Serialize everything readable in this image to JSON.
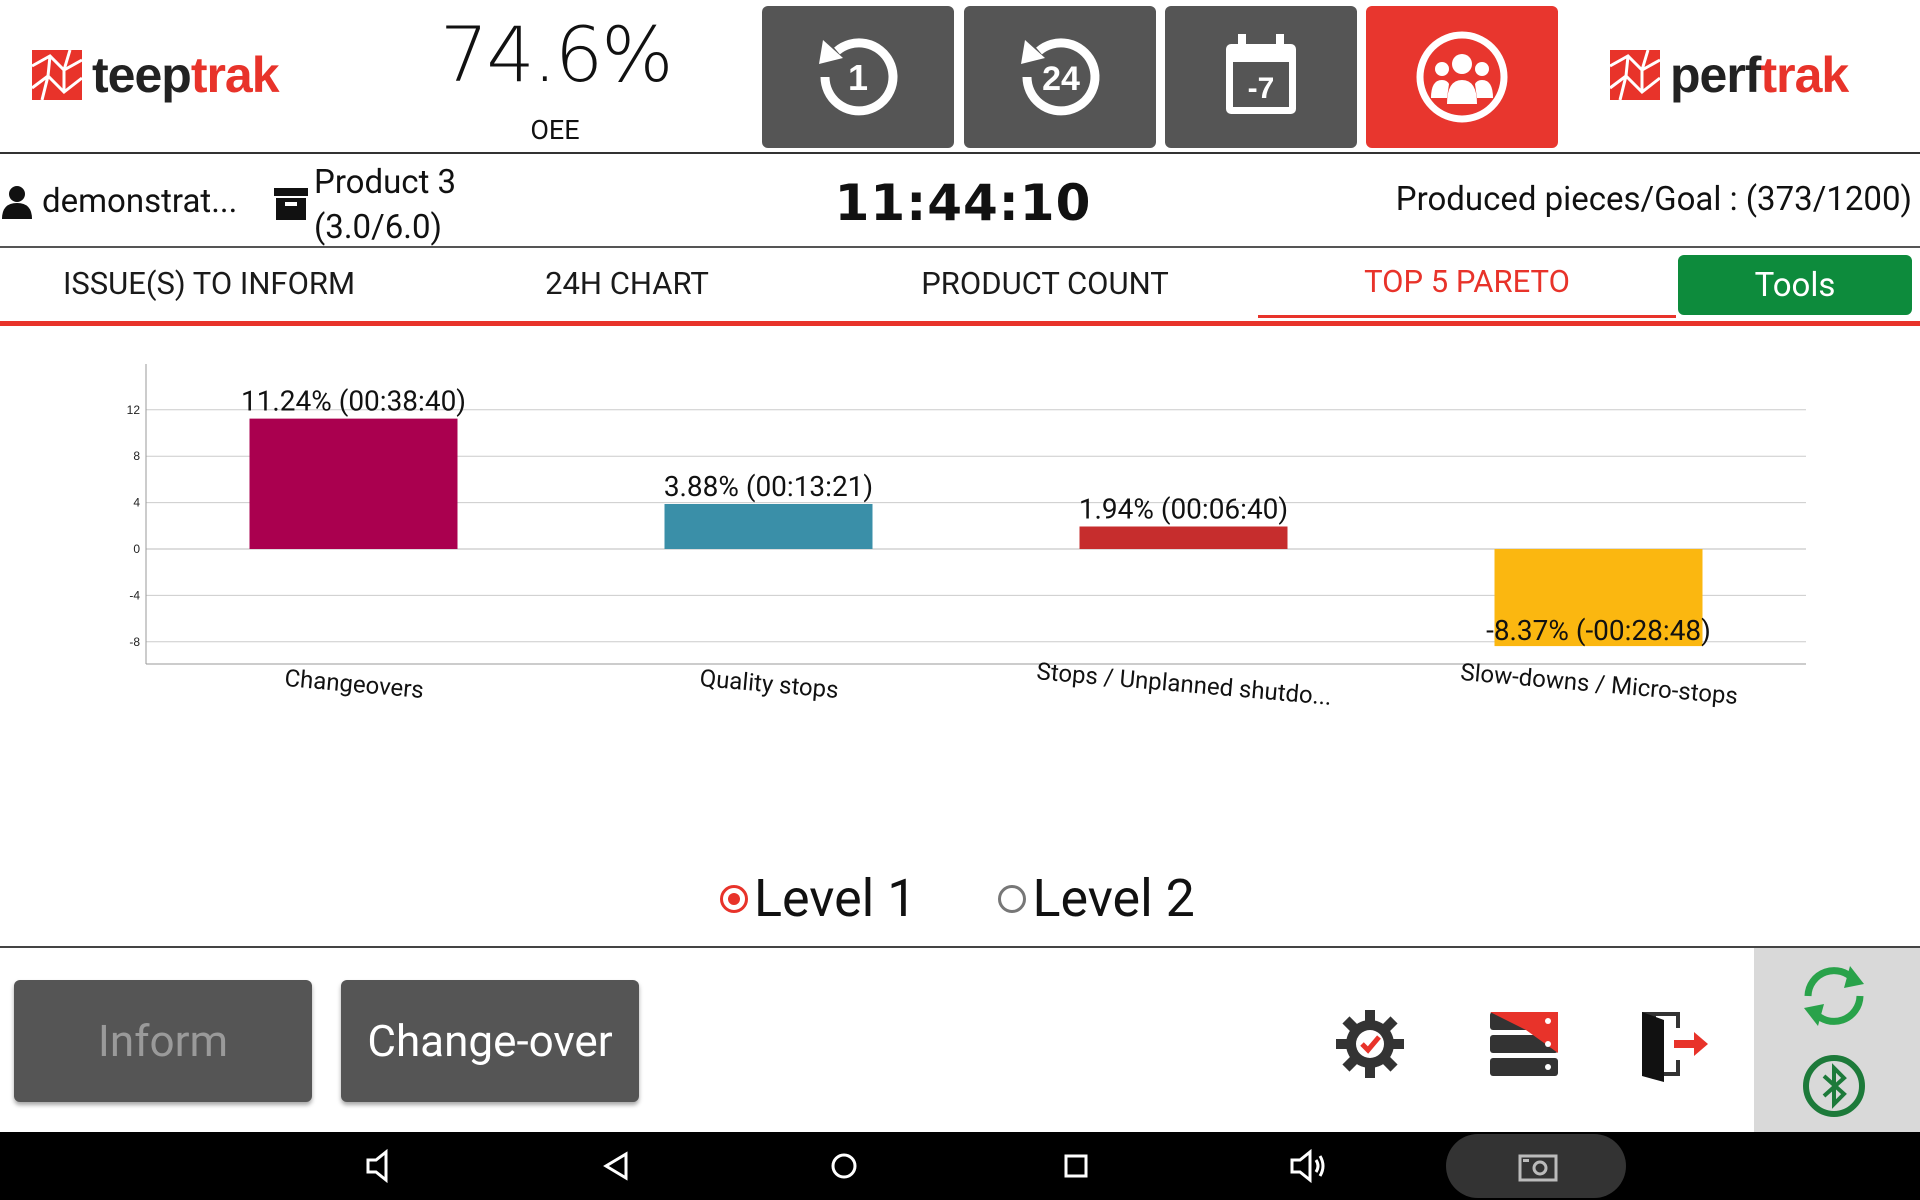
{
  "header": {
    "left_logo": {
      "part1": "teep",
      "part2": "trak"
    },
    "right_logo": {
      "part1": "perf",
      "part2": "trak"
    },
    "oee_value": "74.6%",
    "oee_label": "OEE",
    "period_buttons": [
      {
        "label": "1",
        "icon": "history-1h-icon"
      },
      {
        "label": "24",
        "icon": "history-24h-icon"
      },
      {
        "label": "-7",
        "icon": "calendar-7d-icon"
      },
      {
        "icon": "team-icon",
        "active": true
      }
    ]
  },
  "infobar": {
    "user": "demonstrat...",
    "product_name": "Product 3",
    "product_value": "(3.0/6.0)",
    "clock": "11:44:10",
    "goal_label": "Produced pieces/Goal :",
    "goal_value": "(373/1200)"
  },
  "tabs": [
    {
      "label": "ISSUE(S) TO INFORM",
      "active": false
    },
    {
      "label": "24H CHART",
      "active": false
    },
    {
      "label": "PRODUCT COUNT",
      "active": false
    },
    {
      "label": "TOP 5 PARETO",
      "active": true
    }
  ],
  "tools_label": "Tools",
  "chart_data": {
    "type": "bar",
    "categories": [
      "Changeovers",
      "Quality stops",
      "Stops / Unplanned shutdo...",
      "Slow-downs / Micro-stops"
    ],
    "values": [
      11.24,
      3.88,
      1.94,
      -8.37
    ],
    "labels": [
      "11.24%  (00:38:40)",
      "3.88%  (00:13:21)",
      "1.94%  (00:06:40)",
      "-8.37%  (-00:28:48)"
    ],
    "colors": [
      "#aa004f",
      "#3a8fa8",
      "#c62d2d",
      "#fbb710"
    ],
    "yticks": [
      12,
      8,
      4,
      0,
      -4,
      -8
    ],
    "ylim": [
      -8,
      12
    ],
    "grid": true
  },
  "levels": [
    {
      "label": "Level 1",
      "selected": true
    },
    {
      "label": "Level 2",
      "selected": false
    }
  ],
  "footer": {
    "inform_label": "Inform",
    "changeover_label": "Change-over"
  },
  "colors": {
    "accent_red": "#e8332a",
    "tools_green": "#0d8b3c",
    "button_gray": "#555555"
  }
}
